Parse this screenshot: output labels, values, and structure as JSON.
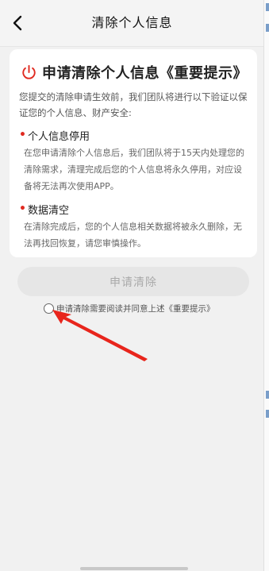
{
  "header": {
    "title": "清除个人信息"
  },
  "card": {
    "title": "申请清除个人信息《重要提示》",
    "intro": "您提交的清除申请生效前，我们团队将进行以下验证以保证您的个人信息、财产安全:",
    "items": [
      {
        "heading": "个人信息停用",
        "desc": "在您申请清除个人信息后，我们团队将于15天内处理您的清除需求，清理完成后您的个人信息将永久停用，对应设备将无法再次使用APP。"
      },
      {
        "heading": "数据清空",
        "desc": "在清除完成后，您的个人信息相关数据将被永久删除，无法再找回恢复，请您审慎操作。"
      }
    ]
  },
  "apply_button": {
    "label": "申请清除",
    "enabled": false
  },
  "agreement": {
    "text": "申请清除需要阅读并同意上述《重要提示》",
    "checked": false
  },
  "colors": {
    "accent_red": "#e02a20",
    "button_disabled_bg": "#e6e6e6",
    "button_disabled_text": "#aaaaaa",
    "page_bg": "#f1f1f1"
  },
  "icons": {
    "back": "chevron-left-icon",
    "power": "power-icon",
    "annotation": "red-arrow-icon"
  }
}
